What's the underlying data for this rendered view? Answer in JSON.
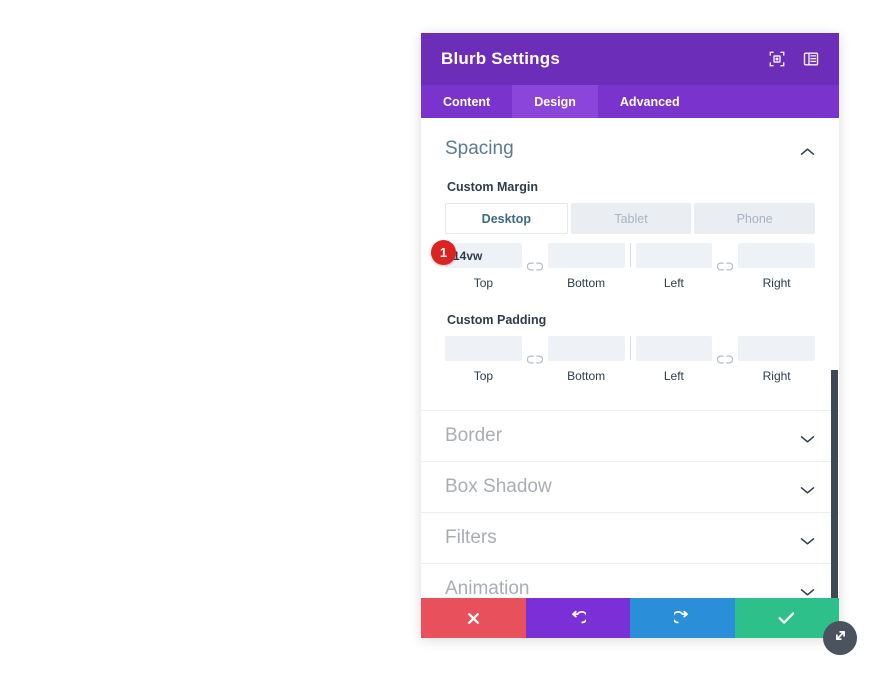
{
  "panel": {
    "title": "Blurb Settings",
    "header_icons": [
      {
        "name": "focus-target-icon"
      },
      {
        "name": "layout-panel-icon"
      }
    ],
    "tabs": [
      {
        "label": "Content",
        "active": false
      },
      {
        "label": "Design",
        "active": true
      },
      {
        "label": "Advanced",
        "active": false
      }
    ]
  },
  "spacing": {
    "section_title": "Spacing",
    "expanded": true,
    "custom_margin": {
      "label": "Custom Margin",
      "device_tabs": [
        {
          "label": "Desktop",
          "active": true
        },
        {
          "label": "Tablet",
          "active": false
        },
        {
          "label": "Phone",
          "active": false
        }
      ],
      "fields": [
        {
          "label": "Top",
          "value": "14vw",
          "placeholder": ""
        },
        {
          "label": "Bottom",
          "value": "",
          "placeholder": ""
        },
        {
          "label": "Left",
          "value": "",
          "placeholder": ""
        },
        {
          "label": "Right",
          "value": "",
          "placeholder": ""
        }
      ],
      "badge": "1"
    },
    "custom_padding": {
      "label": "Custom Padding",
      "fields": [
        {
          "label": "Top",
          "value": "",
          "placeholder": ""
        },
        {
          "label": "Bottom",
          "value": "",
          "placeholder": ""
        },
        {
          "label": "Left",
          "value": "",
          "placeholder": ""
        },
        {
          "label": "Right",
          "value": "",
          "placeholder": ""
        }
      ]
    }
  },
  "collapsed_sections": [
    {
      "label": "Border"
    },
    {
      "label": "Box Shadow"
    },
    {
      "label": "Filters"
    },
    {
      "label": "Animation"
    }
  ],
  "footer": {
    "buttons": [
      {
        "name": "cancel-button",
        "icon": "close-x-icon",
        "color": "#e8505b"
      },
      {
        "name": "undo-button",
        "icon": "undo-arrow-icon",
        "color": "#7b2fd6"
      },
      {
        "name": "redo-button",
        "icon": "redo-arrow-icon",
        "color": "#2a8fd8"
      },
      {
        "name": "save-button",
        "icon": "checkmark-icon",
        "color": "#2ec08b"
      }
    ]
  },
  "resize_handle": {
    "icon": "diagonal-resize-icon"
  },
  "colors": {
    "header_purple": "#6c2eb9",
    "tabbar_purple": "#7a33cc",
    "tab_active_purple": "#8b45da",
    "section_title_blue": "#5b7b93",
    "badge_red": "#dd2222",
    "scrollbar_dark": "#3f4954"
  }
}
